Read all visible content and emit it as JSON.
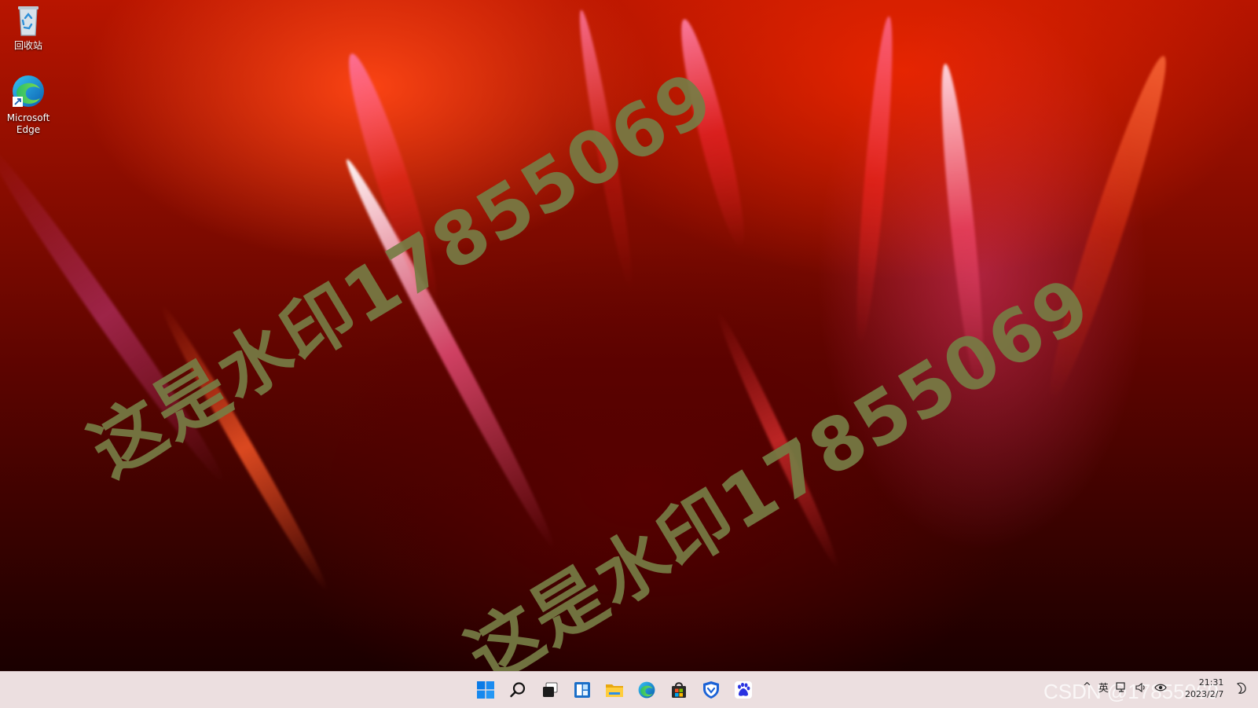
{
  "desktop": {
    "icons": [
      {
        "label": "回收站",
        "icon": "recycle-bin-icon"
      },
      {
        "label": "Microsoft Edge",
        "icon": "edge-icon"
      }
    ]
  },
  "watermarks": {
    "upper": "这是水印17855069",
    "lower": "这是水印17855069",
    "corner": "CSDN @17855069"
  },
  "taskbar": {
    "apps": [
      "windows-start-icon",
      "search-icon",
      "task-view-icon",
      "widgets-icon",
      "file-explorer-icon",
      "edge-icon",
      "microsoft-store-icon",
      "security-shield-icon",
      "baidu-paw-icon"
    ],
    "tray": {
      "chevron": "^",
      "ime": "英",
      "time": "21:31",
      "date": "2023/2/7"
    }
  },
  "colors": {
    "taskbar_bg": "#ecdfe0",
    "watermark": "#767c44",
    "windows_blue": "#0078d4"
  }
}
